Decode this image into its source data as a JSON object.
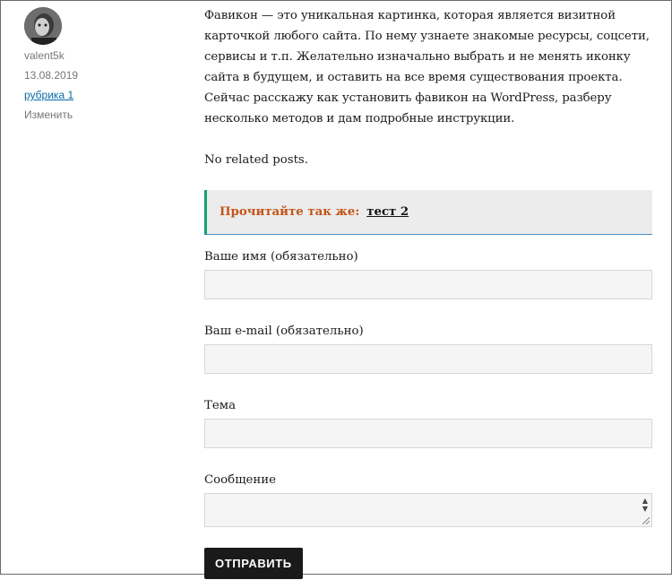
{
  "author": {
    "name": "valent5k",
    "date": "13.08.2019",
    "category": "рубрика 1",
    "edit_label": "Изменить"
  },
  "article": {
    "paragraph": "Фавикон — это уникальная картинка, которая является визитной карточкой любого сайта. По нему узнаете знакомые ресурсы, соцсети, сервисы и т.п. Желательно изначально выбрать и не менять иконку сайта в будущем, и оставить на все время существования проекта. Сейчас расскажу как установить фавикон на WordPress, разберу несколько методов и дам подробные инструкции.",
    "related": "No related posts."
  },
  "read_also": {
    "label": "Прочитайте так же:",
    "link": "тест 2"
  },
  "form": {
    "name_label": "Ваше имя (обязательно)",
    "email_label": "Ваш e-mail (обязательно)",
    "subject_label": "Тема",
    "message_label": "Сообщение",
    "submit_label": "ОТПРАВИТЬ"
  },
  "colors": {
    "read_also_label": "#c25418",
    "read_also_border": "#1b9c79",
    "button_bg": "#1a1a1a"
  }
}
